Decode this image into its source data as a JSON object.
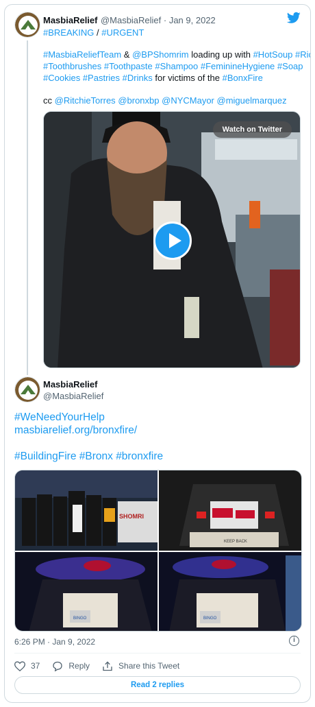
{
  "tweet1": {
    "display_name": "MasbiaRelief",
    "handle_date": "@MasbiaRelief · Jan 9, 2022",
    "line1_parts": [
      "#BREAKING",
      " / ",
      "#URGENT"
    ],
    "body_line1": [
      "#MasbiaReliefTeam",
      " & ",
      "@BPShomrim",
      " loading up with ",
      "#HotSoup",
      " ",
      "#Rice"
    ],
    "body_line2": [
      "#Toothbrushes",
      " ",
      "#Toothpaste",
      " ",
      "#Shampoo",
      " ",
      "#FeminineHygiene",
      " ",
      "#Soap"
    ],
    "body_line3": [
      "#Cookies",
      " ",
      "#Pastries",
      " ",
      "#Drinks",
      " for victims of the ",
      "#BonxFire"
    ],
    "cc_line": [
      "cc ",
      "@RitchieTorres",
      " ",
      "@bronxbp",
      " ",
      "@NYCMayor",
      " ",
      "@miguelmarquez"
    ],
    "video": {
      "watch_label": "Watch on Twitter"
    }
  },
  "tweet2": {
    "display_name": "MasbiaRelief",
    "handle": "@MasbiaRelief",
    "line1": "#WeNeedYourHelp",
    "line2": "masbiarelief.org/bronxfire/",
    "line3": "#BuildingFire #Bronx #bronxfire",
    "photo_captions": [
      "SHOMRI",
      "KEEP BACK",
      "BINGO",
      "BINGO"
    ]
  },
  "footer": {
    "timestamp": "6:26 PM · Jan 9, 2022",
    "info": "i",
    "likes": "37",
    "reply_label": "Reply",
    "share_label": "Share this Tweet",
    "read_replies": "Read 2 replies"
  },
  "colors": {
    "link": "#1d9bf0",
    "muted": "#536471",
    "border": "#cfd9de"
  }
}
